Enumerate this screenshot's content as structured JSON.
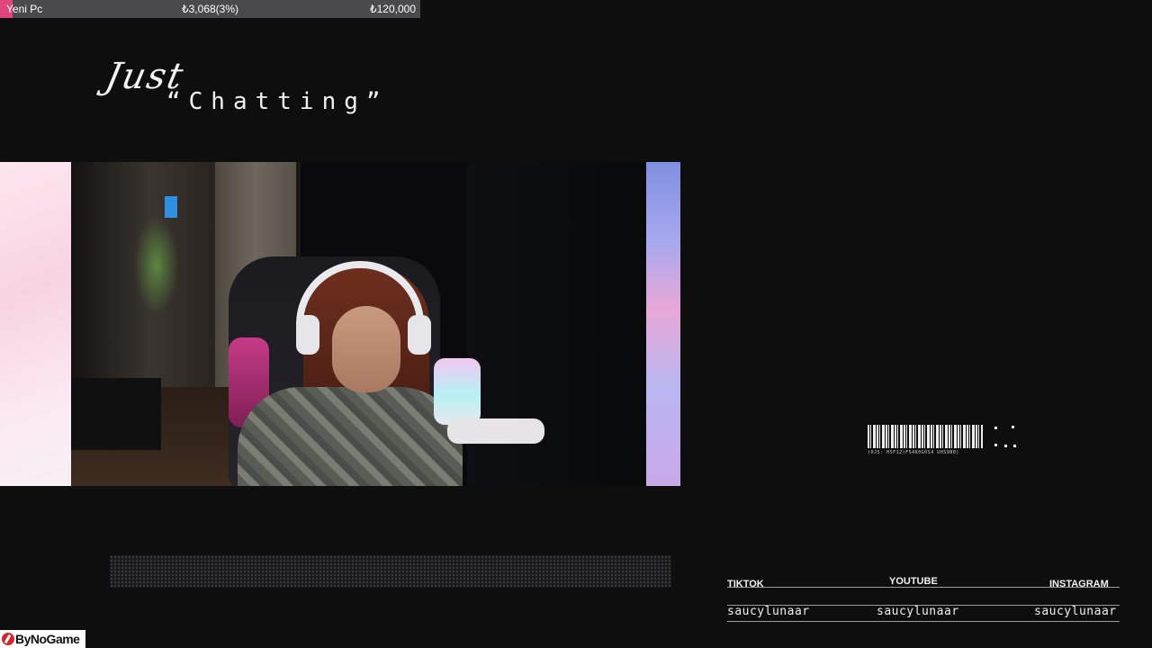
{
  "goal": {
    "name": "Yeni Pc",
    "progress_text": "₺3,068(3%)",
    "target_text": "₺120,000",
    "progress_fraction": 0.03,
    "fill_color": "#e0457b",
    "track_color": "#4a4a4d"
  },
  "title": {
    "script": "Just",
    "main": "“Chatting”"
  },
  "barcode": {
    "code_text": "(0JS: H5F12)F54K0G0S4 UHS9B0)"
  },
  "socials": [
    {
      "platform": "TIKTOK",
      "handle": "saucylunaar"
    },
    {
      "platform": "YOUTUBE",
      "handle": "saucylunaar"
    },
    {
      "platform": "INSTAGRAM",
      "handle": "saucylunaar"
    }
  ],
  "watermark": {
    "text": "ByNoGame",
    "icon": "bynogame-logo-icon"
  },
  "colors": {
    "background": "#0e0e0f",
    "frame_left_gradient": "#f7d3e2",
    "frame_right_gradient": "#a9a9ee"
  }
}
